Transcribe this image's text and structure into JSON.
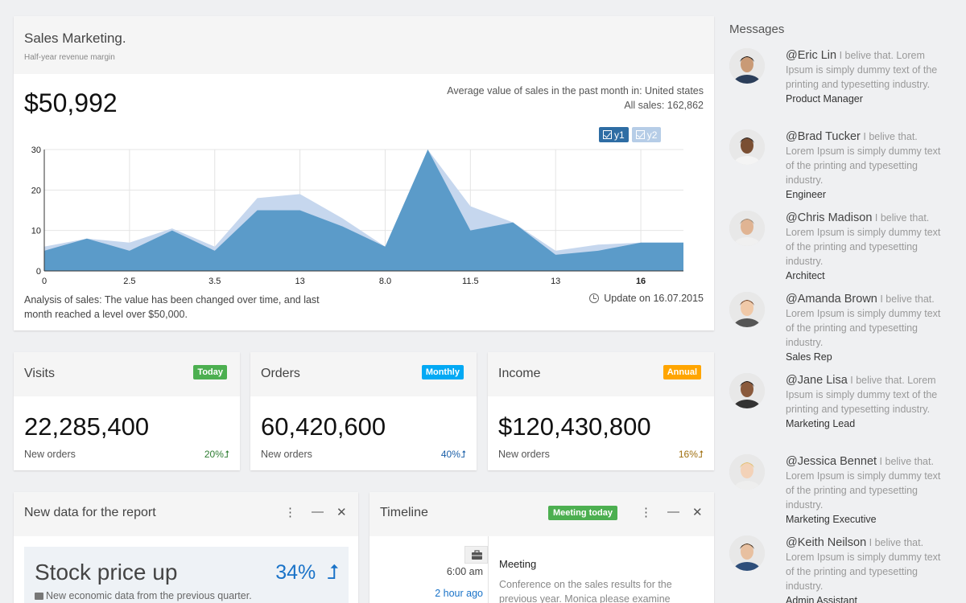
{
  "sales": {
    "title": "Sales Marketing.",
    "subtitle": "Half-year revenue margin",
    "amount": "$50,992",
    "avg_text": "Average value of sales in the past month in: United states",
    "all_sales": "All sales: 162,862",
    "analysis": "Analysis of sales: The value has been changed over time, and last month reached a level over $50,000.",
    "update": "Update on 16.07.2015",
    "legend": [
      "y1",
      "y2"
    ]
  },
  "chart_data": {
    "type": "area",
    "x": [
      0,
      1,
      2,
      3,
      4,
      5,
      6,
      7,
      8,
      9,
      10,
      11,
      12,
      13,
      14,
      15
    ],
    "xticks": [
      {
        "pos": 0,
        "label": "0"
      },
      {
        "pos": 2,
        "label": "2.5"
      },
      {
        "pos": 4,
        "label": "3.5"
      },
      {
        "pos": 6,
        "label": "13"
      },
      {
        "pos": 8,
        "label": "8.0"
      },
      {
        "pos": 10,
        "label": "11.5"
      },
      {
        "pos": 12,
        "label": "13"
      },
      {
        "pos": 14,
        "label": "16"
      }
    ],
    "ylim": [
      0,
      30
    ],
    "yticks": [
      0,
      10,
      20,
      30
    ],
    "grid": true,
    "legend": "top-right",
    "series": [
      {
        "name": "y1",
        "values": [
          5,
          8,
          5,
          10,
          5,
          15,
          15,
          11,
          6,
          30,
          10,
          12,
          4,
          5,
          7,
          7
        ]
      },
      {
        "name": "y2",
        "values": [
          6,
          8,
          7,
          10.5,
          6,
          18,
          19,
          13,
          6,
          30,
          16,
          12,
          5,
          6.5,
          7,
          7
        ]
      }
    ],
    "colors": {
      "y1": "#5b9bc9",
      "y2": "#c6d7ee"
    }
  },
  "stats": [
    {
      "title": "Visits",
      "badge": "Today",
      "badge_color": "#4caf50",
      "value": "22,285,400",
      "label": "New orders",
      "pct": "20%",
      "pct_color": "#2e7d32"
    },
    {
      "title": "Orders",
      "badge": "Monthly",
      "badge_color": "#03a9f4",
      "value": "60,420,600",
      "label": "New orders",
      "pct": "40%",
      "pct_color": "#1a5fa8"
    },
    {
      "title": "Income",
      "badge": "Annual",
      "badge_color": "#ffa500",
      "value": "$120,430,800",
      "label": "New orders",
      "pct": "16%",
      "pct_color": "#a07010"
    }
  ],
  "report": {
    "title": "New data for the report",
    "stock_title": "Stock price up",
    "stock_pct": "34%",
    "stock_sub": "New economic data from the previous quarter."
  },
  "timeline": {
    "title": "Timeline",
    "badge": "Meeting today",
    "time": "6:00 am",
    "ago": "2 hour ago",
    "event": "Meeting",
    "desc": "Conference on the sales results for the previous year. Monica please examine"
  },
  "messages": {
    "title": "Messages",
    "items": [
      {
        "name": "@Eric Lin",
        "text": "I belive that. Lorem Ipsum is simply dummy text of the printing and typesetting industry.",
        "role": "Product Manager"
      },
      {
        "name": "@Brad Tucker",
        "text": "I belive that. Lorem Ipsum is simply dummy text of the printing and typesetting industry.",
        "role": "Engineer"
      },
      {
        "name": "@Chris Madison",
        "text": "I belive that. Lorem Ipsum is simply dummy text of the printing and typesetting industry.",
        "role": "Architect"
      },
      {
        "name": "@Amanda Brown",
        "text": "I belive that. Lorem Ipsum is simply dummy text of the printing and typesetting industry.",
        "role": "Sales Rep"
      },
      {
        "name": "@Jane Lisa",
        "text": "I belive that. Lorem Ipsum is simply dummy text of the printing and typesetting industry.",
        "role": "Marketing Lead"
      },
      {
        "name": "@Jessica Bennet",
        "text": "I belive that. Lorem Ipsum is simply dummy text of the printing and typesetting industry.",
        "role": "Marketing Executive"
      },
      {
        "name": "@Keith Neilson",
        "text": "I belive that. Lorem Ipsum is simply dummy text of the printing and typesetting industry.",
        "role": "Admin Assistant"
      }
    ]
  }
}
